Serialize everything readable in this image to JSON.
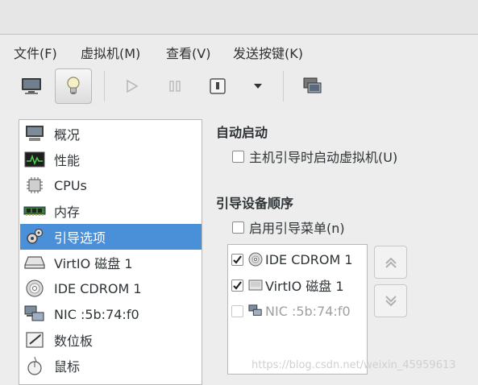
{
  "menubar": {
    "items": [
      {
        "label": "文件(F)"
      },
      {
        "label": "虚拟机(M)"
      },
      {
        "label": "查看(V)"
      },
      {
        "label": "发送按键(K)"
      }
    ]
  },
  "toolbar": {
    "buttons": [
      {
        "icon": "monitor-icon",
        "active": false
      },
      {
        "icon": "lightbulb-icon",
        "active": true
      },
      {
        "icon": "play-icon",
        "active": false,
        "disabled": true
      },
      {
        "icon": "pause-icon",
        "active": false,
        "disabled": true
      },
      {
        "icon": "power-icon",
        "active": false
      },
      {
        "icon": "dropdown-arrow-icon",
        "active": false
      },
      {
        "icon": "snapshot-icon",
        "active": false
      }
    ]
  },
  "sidebar": {
    "items": [
      {
        "label": "概况",
        "icon": "computer-icon"
      },
      {
        "label": "性能",
        "icon": "performance-icon"
      },
      {
        "label": "CPUs",
        "icon": "cpu-icon"
      },
      {
        "label": "内存",
        "icon": "memory-icon"
      },
      {
        "label": "引导选项",
        "icon": "boot-options-icon",
        "selected": true
      },
      {
        "label": "VirtIO 磁盘 1",
        "icon": "disk-icon"
      },
      {
        "label": "IDE CDROM 1",
        "icon": "cdrom-icon"
      },
      {
        "label": "NIC :5b:74:f0",
        "icon": "network-icon"
      },
      {
        "label": "数位板",
        "icon": "tablet-icon"
      },
      {
        "label": "鼠标",
        "icon": "mouse-icon"
      }
    ]
  },
  "autostart": {
    "title": "自动启动",
    "checkbox_label": "主机引导时启动虚拟机(U)",
    "checked": false
  },
  "boot_order": {
    "title": "引导设备顺序",
    "menu_checkbox_label": "启用引导菜单(n)",
    "menu_checked": false,
    "devices": [
      {
        "label": "IDE CDROM 1",
        "checked": true,
        "enabled": true,
        "icon": "cdrom-icon"
      },
      {
        "label": "VirtIO 磁盘 1",
        "checked": true,
        "enabled": true,
        "icon": "disk-icon"
      },
      {
        "label": "NIC :5b:74:f0",
        "checked": false,
        "enabled": false,
        "icon": "network-icon"
      }
    ]
  },
  "watermark": "https://blog.csdn.net/weixin_45959613",
  "colors": {
    "selection": "#4a90d9",
    "background": "#ededed"
  }
}
